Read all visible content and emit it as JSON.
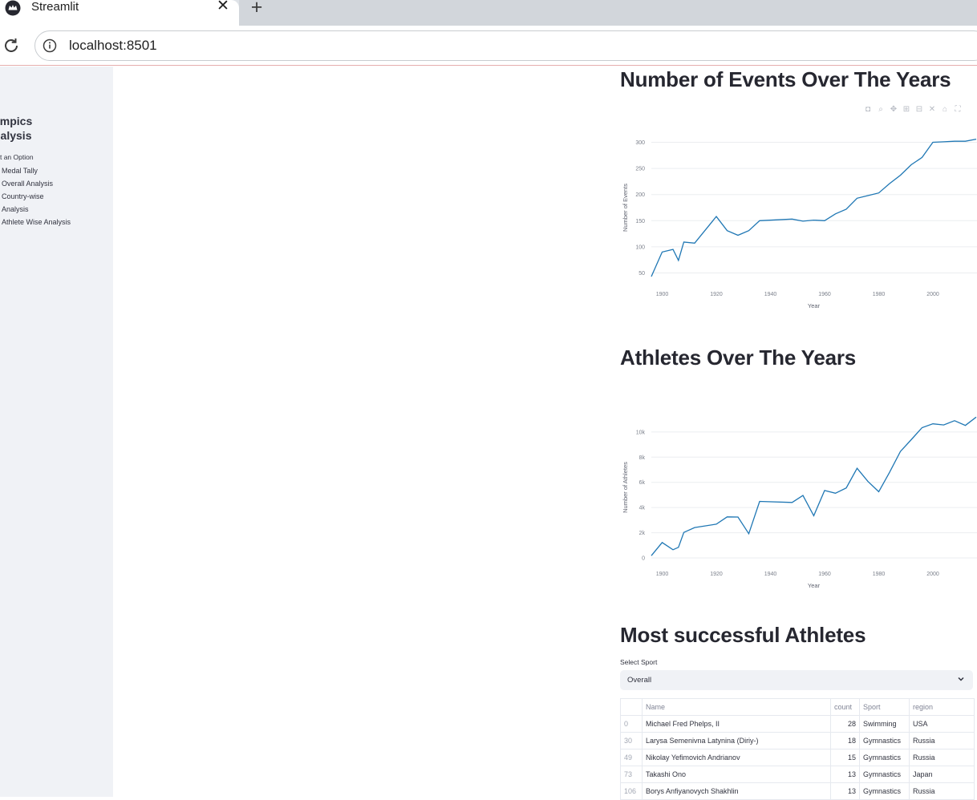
{
  "browser": {
    "tab_title": "Streamlit",
    "url": "localhost:8501"
  },
  "sidebar": {
    "title_line1": "ympics",
    "title_line2": "nalysis",
    "radio_label": "ect an Option",
    "options": [
      "Medal Tally",
      "Overall Analysis",
      "Country-wise",
      "Analysis",
      "Athlete Wise Analysis"
    ]
  },
  "main": {
    "events_heading": "Number of Events Over The Years",
    "athletes_heading": "Athletes Over The Years",
    "successful_heading": "Most successful Athletes",
    "select_label": "Select Sport",
    "select_value": "Overall"
  },
  "chart_data": [
    {
      "type": "line",
      "xlabel": "Year",
      "ylabel": "Number of Events",
      "xticks": [
        "1900",
        "1920",
        "1940",
        "1960",
        "1980",
        "2000"
      ],
      "yticks": [
        "50",
        "100",
        "150",
        "200",
        "250",
        "300"
      ],
      "xlim": [
        1896,
        2016
      ],
      "ylim": [
        40,
        310
      ],
      "x": [
        1896,
        1900,
        1904,
        1906,
        1908,
        1912,
        1920,
        1924,
        1928,
        1932,
        1936,
        1948,
        1952,
        1956,
        1960,
        1964,
        1968,
        1972,
        1976,
        1980,
        1984,
        1988,
        1992,
        1996,
        2000,
        2004,
        2008,
        2012,
        2016
      ],
      "y": [
        43,
        90,
        95,
        74,
        109,
        107,
        158,
        131,
        122,
        131,
        150,
        153,
        149,
        151,
        150,
        163,
        172,
        193,
        198,
        203,
        221,
        237,
        257,
        271,
        300,
        301,
        302,
        302,
        306
      ],
      "color": "#1f77b4"
    },
    {
      "type": "line",
      "xlabel": "Year",
      "ylabel": "Number of Athletes",
      "xticks": [
        "1900",
        "1920",
        "1940",
        "1960",
        "1980",
        "2000"
      ],
      "yticks": [
        "0",
        "2k",
        "4k",
        "6k",
        "8k",
        "10k"
      ],
      "xlim": [
        1896,
        2016
      ],
      "ylim": [
        0,
        11200
      ],
      "x": [
        1896,
        1900,
        1904,
        1906,
        1908,
        1912,
        1920,
        1924,
        1928,
        1932,
        1936,
        1948,
        1952,
        1956,
        1960,
        1964,
        1968,
        1972,
        1976,
        1980,
        1984,
        1988,
        1992,
        1996,
        2000,
        2004,
        2008,
        2012,
        2016
      ],
      "y": [
        176,
        1224,
        650,
        841,
        2024,
        2409,
        2676,
        3256,
        3247,
        1922,
        4484,
        4402,
        4955,
        3347,
        5352,
        5137,
        5558,
        7114,
        6073,
        5259,
        6797,
        8454,
        9386,
        10339,
        10647,
        10557,
        10894,
        10517,
        11179
      ],
      "color": "#1f77b4"
    }
  ],
  "table": {
    "columns": [
      "",
      "Name",
      "count",
      "Sport",
      "region"
    ],
    "rows": [
      [
        "0",
        "Michael Fred Phelps, II",
        "28",
        "Swimming",
        "USA"
      ],
      [
        "30",
        "Larysa Semenivna Latynina (Diriy-)",
        "18",
        "Gymnastics",
        "Russia"
      ],
      [
        "49",
        "Nikolay Yefimovich Andrianov",
        "15",
        "Gymnastics",
        "Russia"
      ],
      [
        "73",
        "Takashi Ono",
        "13",
        "Gymnastics",
        "Japan"
      ],
      [
        "106",
        "Borys Anfiyanovych Shakhlin",
        "13",
        "Gymnastics",
        "Russia"
      ]
    ]
  },
  "icons": {
    "favicon": "streamlit-crown-icon",
    "reload": "reload-icon",
    "info": "info-icon",
    "modebar": [
      "camera-icon",
      "zoom-icon",
      "pan-icon",
      "zoom-in-icon",
      "zoom-out-icon",
      "autoscale-icon",
      "home-icon",
      "fullscreen-icon"
    ]
  }
}
